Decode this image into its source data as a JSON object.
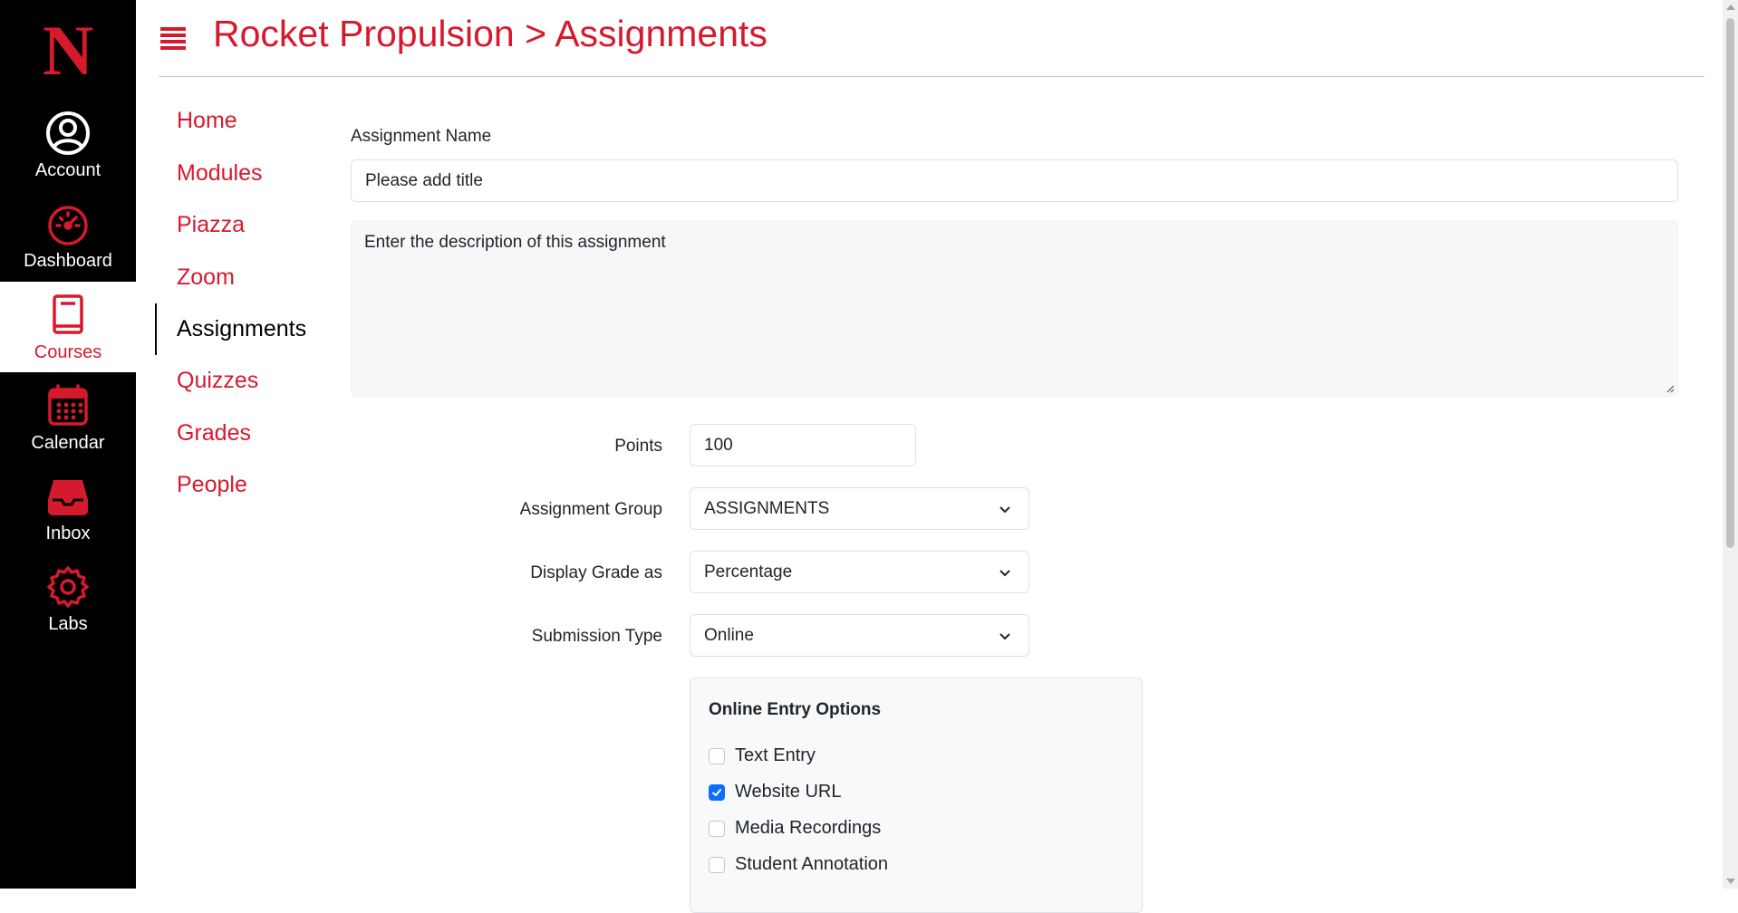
{
  "global_nav": {
    "logo_letter": "N",
    "items": [
      {
        "label": "Account",
        "icon": "user-circle-icon"
      },
      {
        "label": "Dashboard",
        "icon": "speedometer-icon"
      },
      {
        "label": "Courses",
        "icon": "book-icon",
        "active": true
      },
      {
        "label": "Calendar",
        "icon": "calendar-icon"
      },
      {
        "label": "Inbox",
        "icon": "inbox-icon"
      },
      {
        "label": "Labs",
        "icon": "gear-icon"
      }
    ]
  },
  "header": {
    "title": "Rocket Propulsion > Assignments"
  },
  "course_nav": {
    "items": [
      {
        "label": "Home"
      },
      {
        "label": "Modules"
      },
      {
        "label": "Piazza"
      },
      {
        "label": "Zoom"
      },
      {
        "label": "Assignments",
        "active": true
      },
      {
        "label": "Quizzes"
      },
      {
        "label": "Grades"
      },
      {
        "label": "People"
      }
    ]
  },
  "form": {
    "name_label": "Assignment Name",
    "name_value": "Please add title",
    "description_value": "Enter the description of this assignment",
    "points_label": "Points",
    "points_value": "100",
    "group_label": "Assignment Group",
    "group_value": "ASSIGNMENTS",
    "display_label": "Display Grade as",
    "display_value": "Percentage",
    "submission_label": "Submission Type",
    "submission_value": "Online",
    "online_options": {
      "title": "Online Entry Options",
      "options": [
        {
          "label": "Text Entry",
          "checked": false
        },
        {
          "label": "Website URL",
          "checked": true
        },
        {
          "label": "Media Recordings",
          "checked": false
        },
        {
          "label": "Student Annotation",
          "checked": false
        }
      ]
    }
  },
  "colors": {
    "brand_red": "#d51a2e",
    "sidebar_bg": "#000000",
    "checkbox_blue": "#0d6efd"
  }
}
